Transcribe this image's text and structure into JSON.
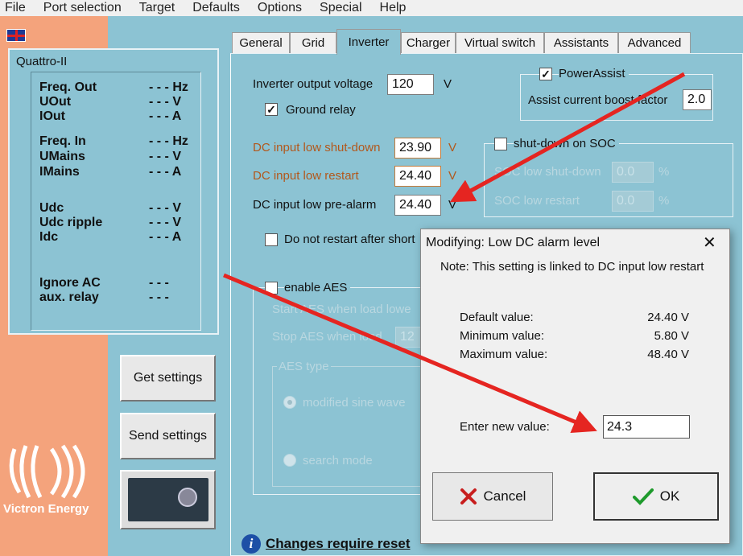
{
  "menu": [
    "File",
    "Port selection",
    "Target",
    "Defaults",
    "Options",
    "Special",
    "Help"
  ],
  "status": {
    "title": "Quattro-II",
    "rows": [
      {
        "label": "Freq. Out",
        "value": "- - - Hz"
      },
      {
        "label": "UOut",
        "value": "- - - V"
      },
      {
        "label": "IOut",
        "value": "- - - A"
      },
      {
        "label": "Freq. In",
        "value": "- - - Hz"
      },
      {
        "label": "UMains",
        "value": "- - - V"
      },
      {
        "label": "IMains",
        "value": "- - - A"
      },
      {
        "label": "Udc",
        "value": "- - - V"
      },
      {
        "label": "Udc ripple",
        "value": "- - - V"
      },
      {
        "label": "Idc",
        "value": "- - - A"
      },
      {
        "label": "Ignore AC",
        "value": "- - -"
      },
      {
        "label": "aux. relay",
        "value": "- - -"
      }
    ]
  },
  "buttons": {
    "get": "Get settings",
    "send": "Send settings"
  },
  "logo": {
    "name": "Victron Energy"
  },
  "tabs": [
    "General",
    "Grid",
    "Inverter",
    "Charger",
    "Virtual switch",
    "Assistants",
    "Advanced"
  ],
  "inverter": {
    "output_voltage_label": "Inverter output voltage",
    "output_voltage": "120",
    "unit_v": "V",
    "ground_relay": "Ground relay",
    "dc_low_shutdown_label": "DC input low shut-down",
    "dc_low_shutdown": "23.90",
    "dc_low_restart_label": "DC input low restart",
    "dc_low_restart": "24.40",
    "dc_low_prealarm_label": "DC input low pre-alarm",
    "dc_low_prealarm": "24.40",
    "no_restart_label": "Do not restart after short",
    "enable_aes": "enable AES",
    "start_aes": "Start AES when load lowe",
    "stop_aes": "Stop AES when load",
    "stop_aes_value": "12",
    "aes_type": "AES type",
    "modified_sine": "modified sine wave",
    "search_mode": "search mode",
    "powerassist": "PowerAssist",
    "assist_factor_label": "Assist current boost factor",
    "assist_factor": "2.0",
    "shutdown_soc": "shut-down on SOC",
    "soc_shutdown_label": "SOC low shut-down",
    "soc_shutdown": "0.0",
    "soc_restart_label": "SOC low restart",
    "soc_restart": "0.0",
    "pct": "%"
  },
  "dialog": {
    "title": "Modifying: Low DC alarm level",
    "close": "✕",
    "note": "Note: This setting is linked to DC input low restart",
    "default_label": "Default value:",
    "default_value": "24.40 V",
    "min_label": "Minimum value:",
    "min_value": "5.80 V",
    "max_label": "Maximum value:",
    "max_value": "48.40 V",
    "enter_label": "Enter new value:",
    "enter_value": "24.3",
    "cancel": "Cancel",
    "ok": "OK"
  },
  "footer": {
    "reset": "Changes require reset",
    "info_glyph": "i"
  }
}
